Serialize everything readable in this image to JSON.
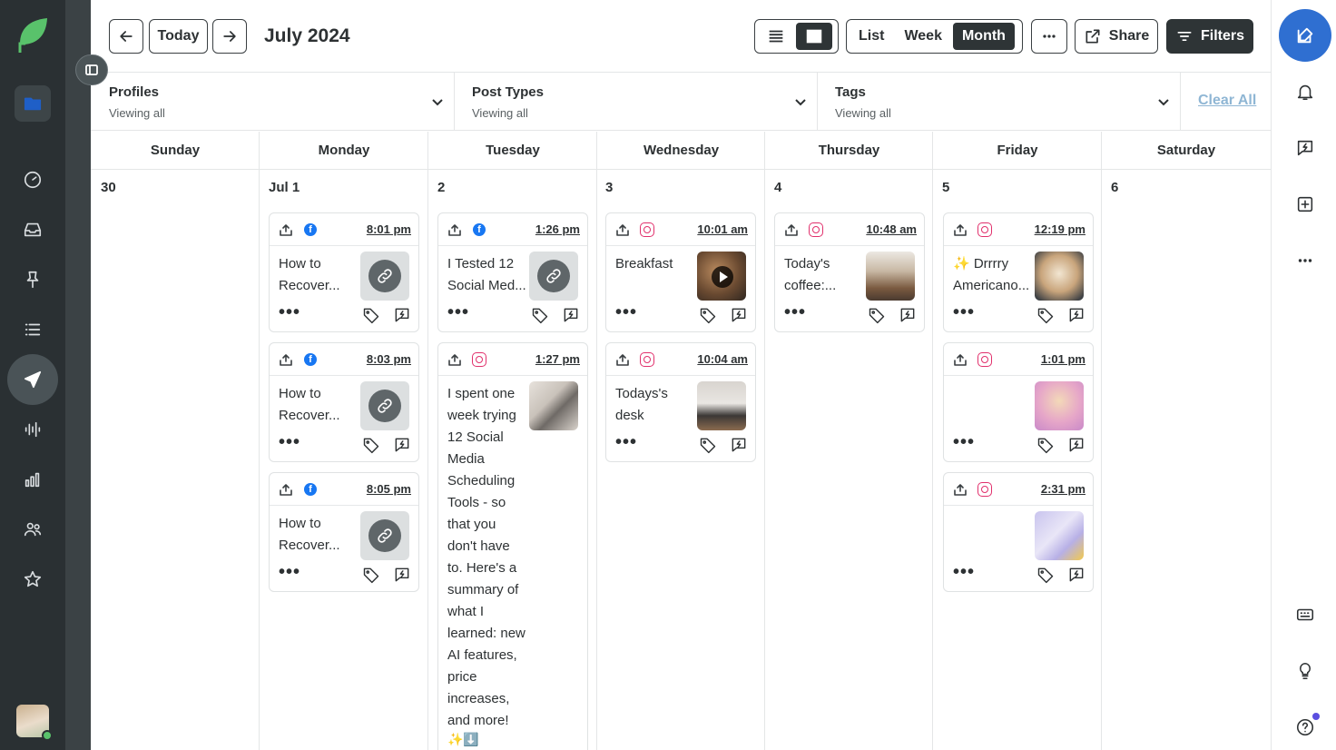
{
  "header": {
    "today_label": "Today",
    "month_title": "July 2024",
    "views": [
      "List",
      "Week",
      "Month"
    ],
    "active_view": "Month",
    "share_label": "Share",
    "filters_label": "Filters"
  },
  "filters": {
    "profiles": {
      "label": "Profiles",
      "value": "Viewing all"
    },
    "post_types": {
      "label": "Post Types",
      "value": "Viewing all"
    },
    "tags": {
      "label": "Tags",
      "value": "Viewing all"
    },
    "clear_all": "Clear All"
  },
  "calendar": {
    "weekdays": [
      "Sunday",
      "Monday",
      "Tuesday",
      "Wednesday",
      "Thursday",
      "Friday",
      "Saturday"
    ],
    "dates": [
      "30",
      "Jul 1",
      "2",
      "3",
      "4",
      "5",
      "6"
    ],
    "posts": {
      "mon1": {
        "network": "facebook",
        "time": "8:01 pm",
        "text": "How to Recover..."
      },
      "mon2": {
        "network": "facebook",
        "time": "8:03 pm",
        "text": "How to Recover..."
      },
      "mon3": {
        "network": "facebook",
        "time": "8:05 pm",
        "text": "How to Recover..."
      },
      "tue1": {
        "network": "facebook",
        "time": "1:26 pm",
        "text": "I Tested 12 Social Med..."
      },
      "tue2": {
        "network": "instagram",
        "time": "1:27 pm",
        "text": "I spent one week trying 12 Social Media Scheduling Tools - so that you don't have to. Here's a summary of what I learned: new AI features, price increases, and more!",
        "emoji": "✨⬇️"
      },
      "wed1": {
        "network": "instagram",
        "time": "10:01 am",
        "text": "Breakfast"
      },
      "wed2": {
        "network": "instagram",
        "time": "10:04 am",
        "text": "Todays's desk"
      },
      "thu1": {
        "network": "instagram",
        "time": "10:48 am",
        "text": "Today's coffee:..."
      },
      "fri1": {
        "network": "instagram",
        "time": "12:19 pm",
        "text": "✨ Drrrry Americano..."
      },
      "fri2": {
        "network": "instagram",
        "time": "1:01 pm",
        "text": ""
      },
      "fri3": {
        "network": "instagram",
        "time": "2:31 pm",
        "text": ""
      }
    }
  },
  "icons": {
    "left_nav": [
      "sprout-logo",
      "folder-icon",
      "gauge-icon",
      "inbox-icon",
      "pin-icon",
      "list-icon",
      "send-icon",
      "audio-wave-icon",
      "bar-chart-icon",
      "people-icon",
      "star-icon"
    ],
    "right_rail": [
      "compose-icon",
      "bell-icon",
      "feedback-icon",
      "add-square-icon",
      "more-icon",
      "keyboard-icon",
      "lightbulb-icon",
      "help-icon"
    ]
  },
  "colors": {
    "nav_bg": "#2a3033",
    "accent_blue": "#2f6fd1",
    "facebook": "#1877f2",
    "instagram": "#e1306c",
    "brand_green": "#59c26b"
  }
}
